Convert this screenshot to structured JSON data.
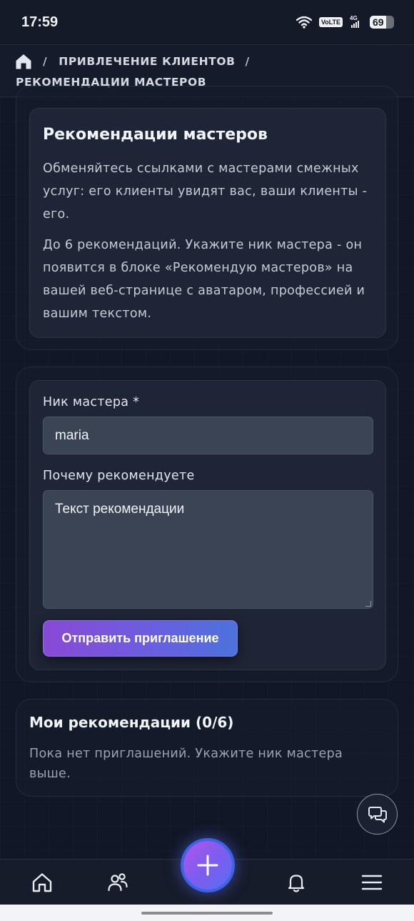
{
  "status_bar": {
    "time": "17:59",
    "volte": "VoLTE",
    "network": "4G",
    "battery": "69",
    "battery_level": 0.69
  },
  "breadcrumb": {
    "sep": "/",
    "item1": "ПРИВЛЕЧЕНИЕ КЛИЕНТОВ",
    "item2": "РЕКОМЕНДАЦИИ МАСТЕРОВ"
  },
  "intro": {
    "title": "Рекомендации мастеров",
    "p1": "Обменяйтесь ссылками с мастерами смежных услуг: его клиенты увидят вас, ваши клиенты - его.",
    "p2": "До 6 рекомендаций. Укажите ник мастера - он появится в блоке «Рекомендую мастеров» на вашей веб-странице с аватаром, профессией и вашим текстом."
  },
  "form": {
    "nick_label": "Ник мастера *",
    "nick_value": "maria",
    "why_label": "Почему рекомендуете",
    "why_placeholder": "Текст рекомендации",
    "submit": "Отправить приглашение"
  },
  "my": {
    "title": "Мои рекомендации (0/6)",
    "empty": "Пока нет приглашений. Укажите ник мастера выше."
  },
  "colors": {
    "accent_start": "#8a49d6",
    "accent_end": "#4d72dc",
    "fab": "#3a64e6",
    "background": "#111726"
  },
  "icons": [
    "home-icon",
    "users-icon",
    "plus-icon",
    "bell-icon",
    "menu-icon",
    "chat-icon",
    "wifi-icon"
  ]
}
